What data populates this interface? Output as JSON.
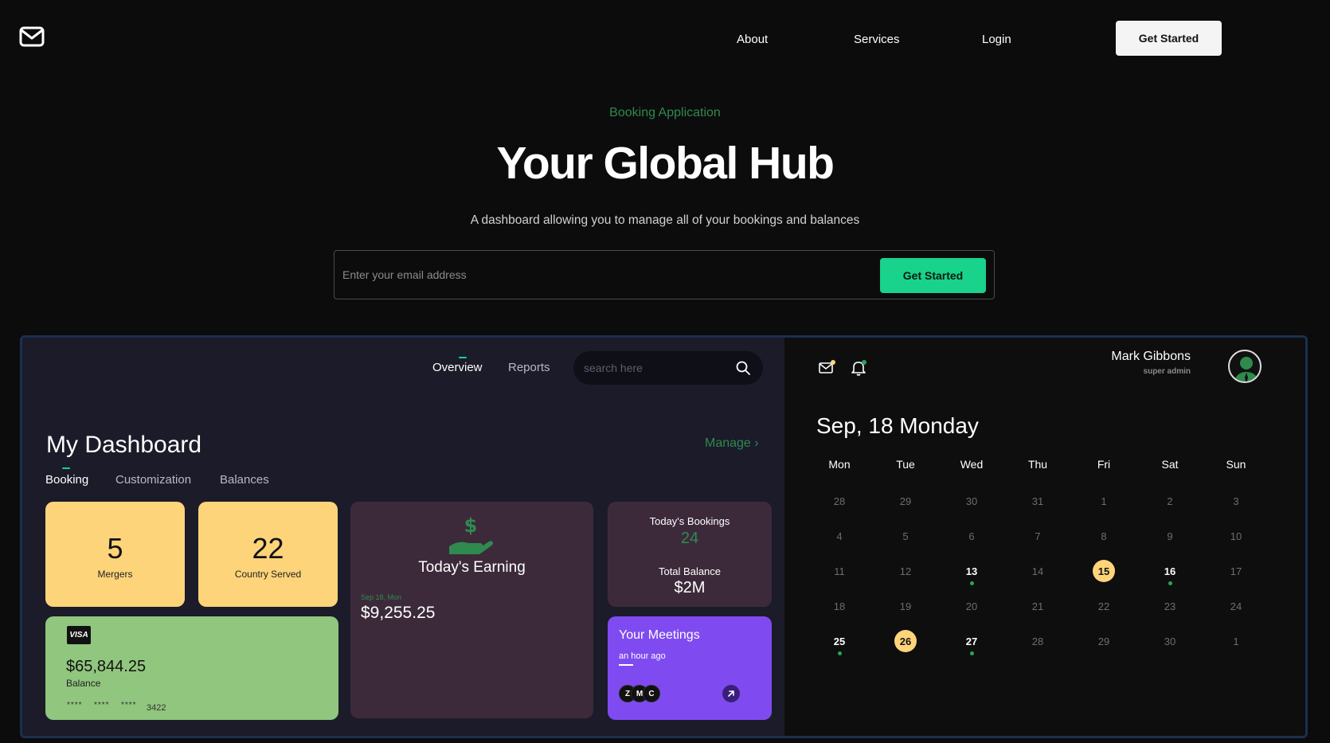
{
  "nav": {
    "about": "About",
    "services": "Services",
    "login": "Login",
    "cta": "Get Started"
  },
  "hero": {
    "eyebrow": "Booking Application",
    "title": "Your Global Hub",
    "subtitle": "A dashboard allowing you to manage all of your bookings and balances",
    "email_placeholder": "Enter your email address",
    "button": "Get Started"
  },
  "dashboard": {
    "tabs": [
      "Overview",
      "Reports"
    ],
    "search_placeholder": "search here",
    "title": "My Dashboard",
    "manage": "Manage ›",
    "subtabs": [
      "Booking",
      "Customization",
      "Balances"
    ],
    "stats": [
      {
        "value": "5",
        "label": "Mergers"
      },
      {
        "value": "22",
        "label": "Country Served"
      }
    ],
    "earning": {
      "title": "Today's Earning",
      "date": "Sep 18, Mon",
      "amount": "$9,255.25"
    },
    "bookings": {
      "label": "Today's Bookings",
      "value": "24",
      "balance_label": "Total Balance",
      "balance_value": "$2M"
    },
    "card": {
      "brand": "VISA",
      "amount": "$65,844.25",
      "label": "Balance",
      "mask": "****",
      "last4": "3422"
    },
    "meetings": {
      "title": "Your Meetings",
      "time": "an hour ago",
      "attendees": [
        "Z",
        "M",
        "C"
      ]
    }
  },
  "calendar": {
    "user_name": "Mark Gibbons",
    "user_role": "super admin",
    "date_title": "Sep, 18 Monday",
    "weekdays": [
      "Mon",
      "Tue",
      "Wed",
      "Thu",
      "Fri",
      "Sat",
      "Sun"
    ],
    "weeks": [
      [
        "28",
        "29",
        "30",
        "31",
        "1",
        "2",
        "3"
      ],
      [
        "4",
        "5",
        "6",
        "7",
        "8",
        "9",
        "10"
      ],
      [
        "11",
        "12",
        "13",
        "14",
        "15",
        "16",
        "17"
      ],
      [
        "18",
        "19",
        "20",
        "21",
        "22",
        "23",
        "24"
      ],
      [
        "25",
        "26",
        "27",
        "28",
        "29",
        "30",
        "1"
      ]
    ],
    "highlighted": [
      "2-2",
      "2-5",
      "4-0",
      "4-2"
    ],
    "selected": [
      "2-4",
      "4-1"
    ],
    "dotted": [
      "2-2",
      "2-5",
      "4-0",
      "4-2"
    ]
  },
  "colors": {
    "accent": "#19d28b",
    "green_text": "#2f8a4e",
    "stat_card": "#fdd47a",
    "earning_card": "#3c2a3b",
    "visa_card": "#90c67e",
    "meetings_card": "#7f4bf0"
  },
  "icons": [
    "mail-logo-icon",
    "search-icon",
    "mail-icon",
    "bell-icon",
    "dollar-hand-icon",
    "arrow-up-right-icon"
  ]
}
